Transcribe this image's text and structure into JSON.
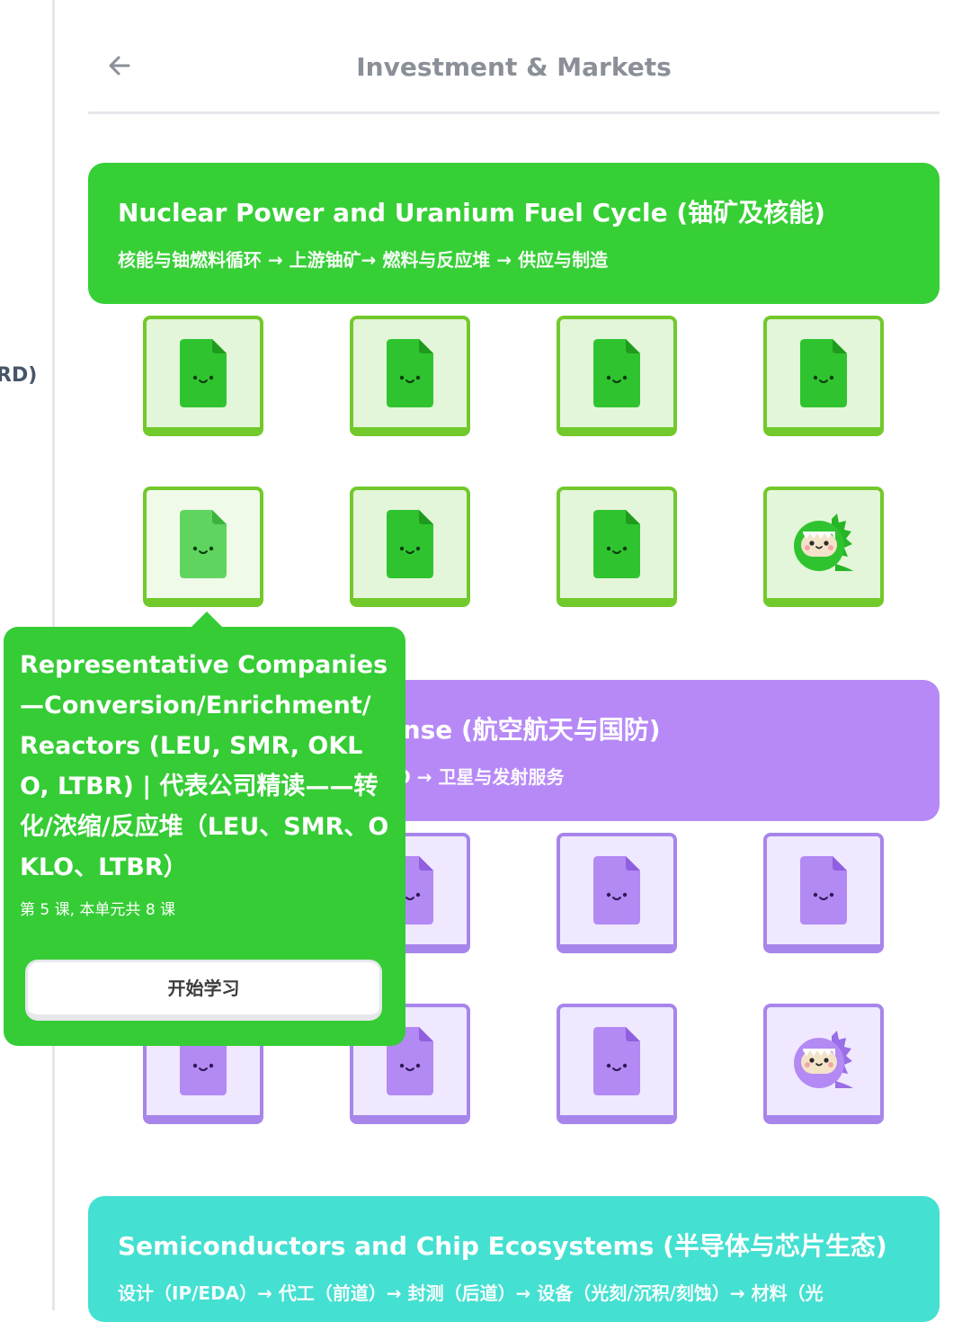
{
  "sidebar": {
    "partial_label": "RD)"
  },
  "header": {
    "title": "Investment & Markets",
    "back_icon": "arrow-left-icon"
  },
  "colors": {
    "green": "#36cf36",
    "purple": "#b689f7",
    "teal": "#44e0d1"
  },
  "units": [
    {
      "title": "Nuclear Power and Uranium Fuel Cycle (铀矿及核能)",
      "subtitle": "核能与铀燃料循环 → 上游铀矿→ 燃料与反应堆 → 供应与制造"
    },
    {
      "title": "Aerospace and Defense (航空航天与国防)",
      "subtitle": "供应链（Tier1/2）→ 组装 → MRO → 卫星与发射服务"
    },
    {
      "title": "Semiconductors and Chip Ecosystems (半导体与芯片生态)",
      "subtitle": "设计（IP/EDA）→ 代工（前道）→ 封测（后道）→ 设备（光刻/沉积/刻蚀）→ 材料（光"
    }
  ],
  "popover": {
    "title": "Representative Companies—Conversion/Enrichment/Reactors (LEU, SMR, OKLO, LTBR) | 代表公司精读——转化/浓缩/反应堆（LEU、SMR、OKLO、LTBR）",
    "meta": "第 5 课, 本单元共 8 课",
    "button": "开始学习"
  }
}
